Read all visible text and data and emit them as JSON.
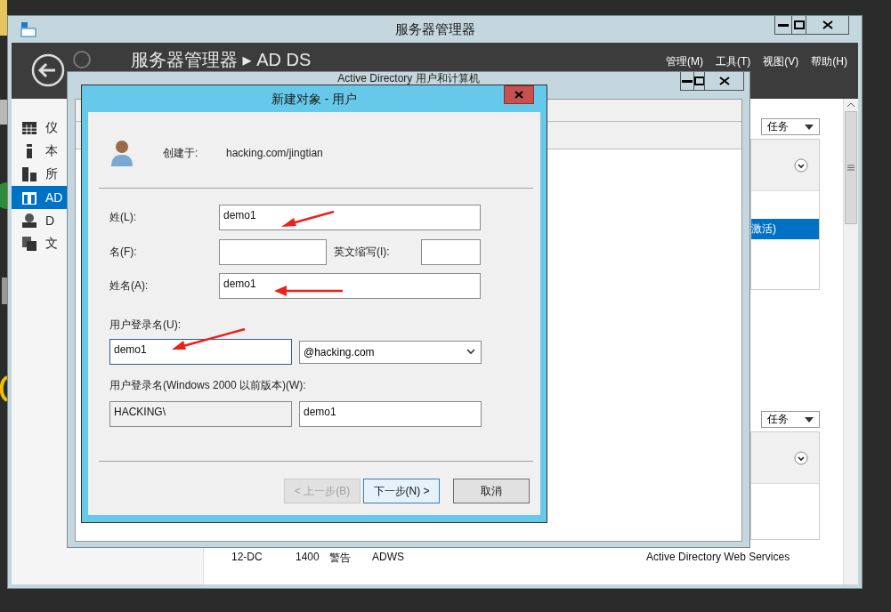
{
  "desktop_icons": [
    {
      "kind": "folder"
    },
    {
      "kind": "drive"
    },
    {
      "kind": "globe"
    },
    {
      "kind": "bin"
    },
    {
      "kind": "browser"
    }
  ],
  "server_manager": {
    "title": "服务器管理器",
    "breadcrumb": "服务器管理器 ▸ AD DS",
    "menu": [
      "管理(M)",
      "工具(T)",
      "视图(V)",
      "帮助(H)"
    ],
    "sidebar": [
      {
        "kind": "dashboard",
        "label": "仪",
        "selected": false
      },
      {
        "kind": "local",
        "label": "本",
        "selected": false
      },
      {
        "kind": "all",
        "label": "所",
        "selected": false
      },
      {
        "kind": "ad",
        "label": "AD",
        "selected": true
      },
      {
        "kind": "dns",
        "label": "D",
        "selected": false
      },
      {
        "kind": "files",
        "label": "文",
        "selected": false
      }
    ],
    "panels": [
      {
        "task_button": "任务",
        "rows": [
          {
            "text": "激活)",
            "selected": true
          }
        ]
      },
      {
        "task_button": "任务"
      }
    ],
    "events": [
      {
        "server": "12-DC",
        "id": "1400",
        "severity": "警告",
        "source": "ADWS",
        "log": "Active Directory Web Services"
      }
    ]
  },
  "ad_window": {
    "title": "Active Directory 用户和计算机"
  },
  "dialog": {
    "title": "新建对象 - 用户",
    "created_in_label": "创建于:",
    "created_in": "hacking.com/jingtian",
    "last_name": {
      "label": "姓(L):",
      "value": "demo1"
    },
    "first_name": {
      "label": "名(F):"
    },
    "initials": {
      "label": "英文缩写(I):"
    },
    "full_name": {
      "label": "姓名(A):",
      "value": "demo1"
    },
    "logon_name": {
      "label": "用户登录名(U):",
      "value": "demo1",
      "domain": "@hacking.com"
    },
    "legacy_logon": {
      "label": "用户登录名(Windows 2000 以前版本)(W):",
      "prefix": "HACKING\\",
      "value": "demo1"
    },
    "buttons": [
      {
        "label": "< 上一步(B)",
        "disabled": true,
        "default": false
      },
      {
        "label": "下一步(N) >",
        "disabled": false,
        "default": true
      },
      {
        "label": "取消",
        "disabled": false,
        "default": false
      }
    ]
  }
}
